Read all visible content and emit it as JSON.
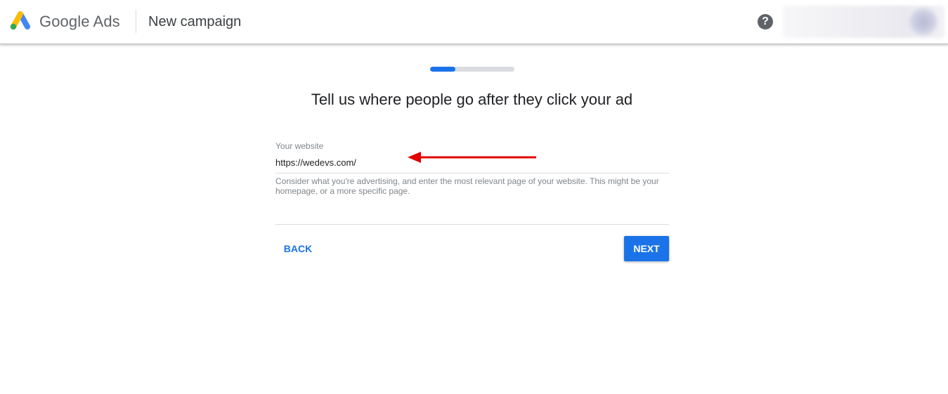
{
  "header": {
    "brand": "Google Ads",
    "page_title": "New campaign",
    "help_icon": "help-circle-icon",
    "help_glyph": "?"
  },
  "progress": {
    "fraction": 0.3,
    "color": "#1a73e8"
  },
  "main": {
    "headline": "Tell us where people go after they click your ad",
    "website_field": {
      "label": "Your website",
      "value": "https://wedevs.com/",
      "hint": "Consider what you're advertising, and enter the most relevant page of your website. This might be your homepage, or a more specific page."
    },
    "annotation": {
      "icon": "arrow-left-icon",
      "color": "#e00000"
    }
  },
  "actions": {
    "back_label": "BACK",
    "next_label": "NEXT"
  },
  "colors": {
    "accent": "#1a73e8",
    "logo_blue": "#4285f4",
    "logo_yellow": "#fbbc04",
    "logo_green": "#34a853"
  }
}
